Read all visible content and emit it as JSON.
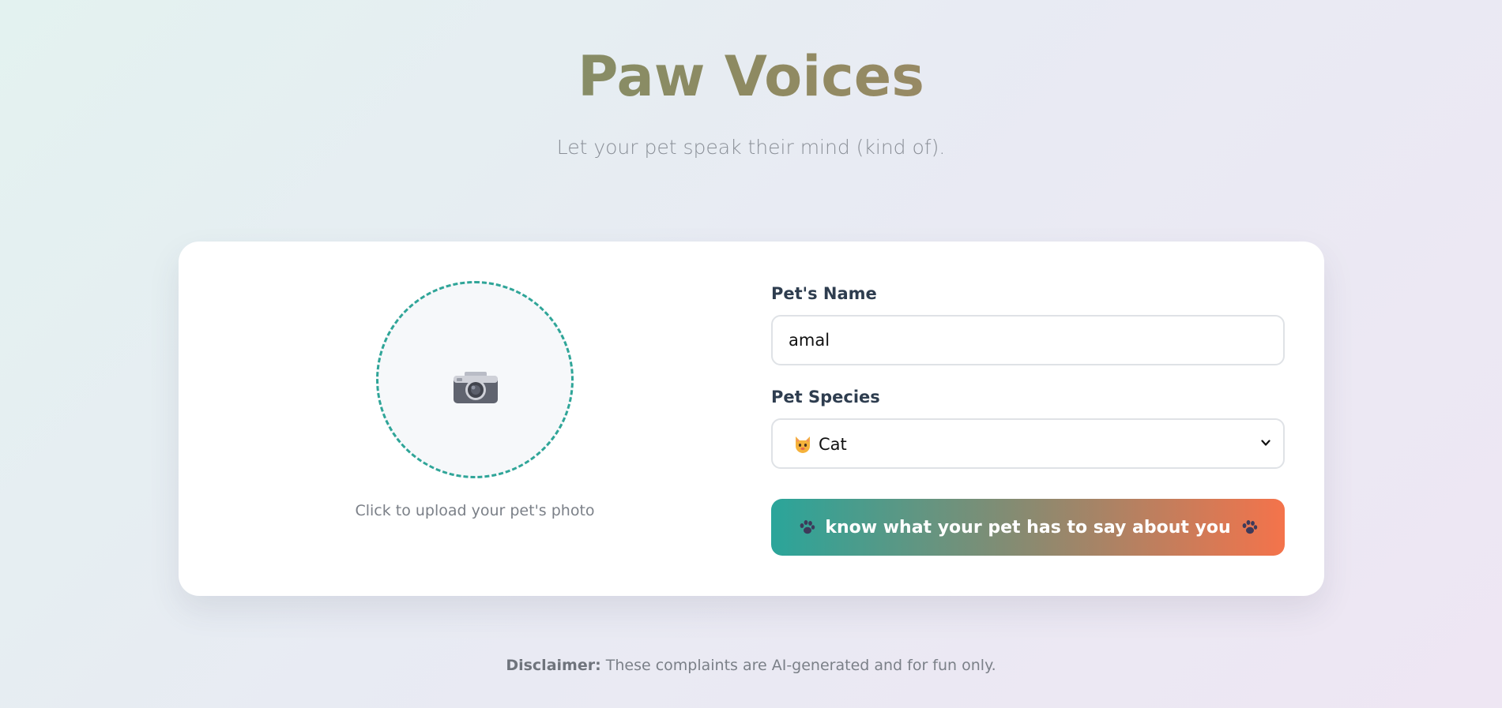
{
  "header": {
    "title": "Paw Voices",
    "subtitle": "Let your pet speak their mind (kind of)."
  },
  "upload": {
    "icon": "camera-icon",
    "hint": "Click to upload your pet's photo"
  },
  "form": {
    "name_label": "Pet's Name",
    "name_value": "amal",
    "species_label": "Pet Species",
    "species_icon": "cat-face-icon",
    "species_value": "Cat",
    "submit_label": "know what your pet has to say about you",
    "submit_icon": "paw-icon"
  },
  "footer": {
    "disclaimer_label": "Disclaimer:",
    "disclaimer_text": " These complaints are AI-generated and for fun only."
  },
  "colors": {
    "accent_teal": "#2aa59a",
    "accent_orange": "#f4734b",
    "title_green": "#6f9672",
    "title_brown": "#b8876a"
  }
}
